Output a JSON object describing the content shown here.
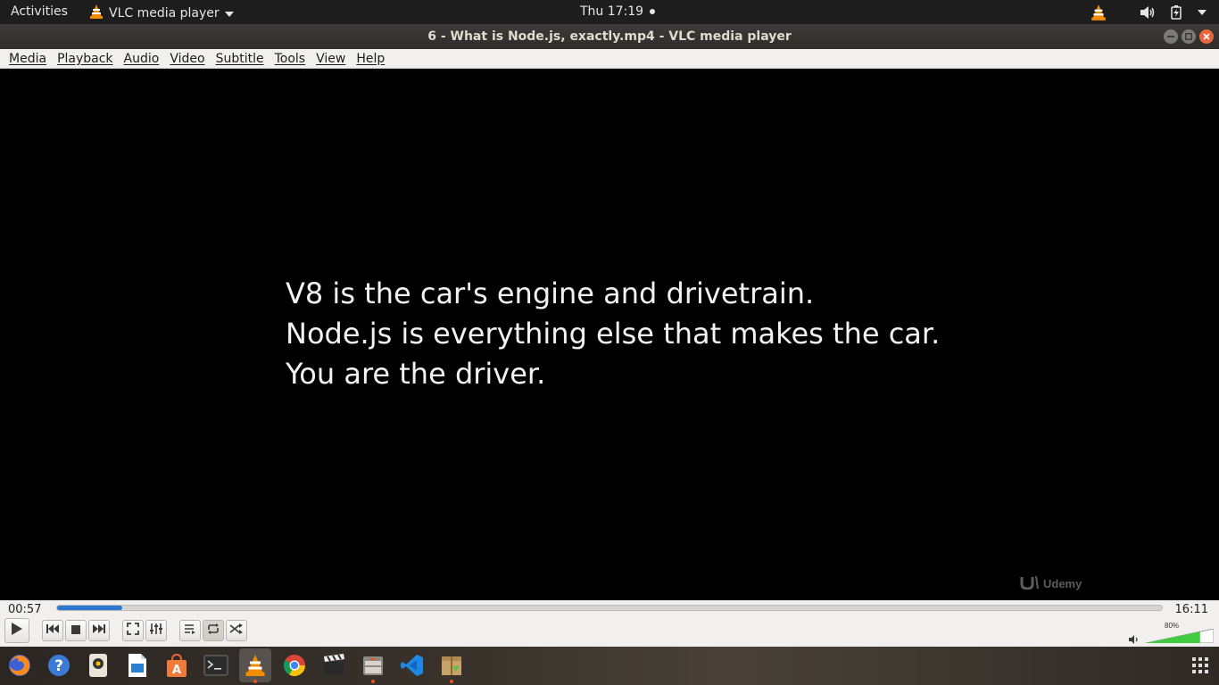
{
  "topbar": {
    "activities": "Activities",
    "app_name": "VLC media player",
    "clock": "Thu 17:19"
  },
  "window": {
    "title": "6 - What is Node.js, exactly.mp4 - VLC media player"
  },
  "menu": [
    "Media",
    "Playback",
    "Audio",
    "Video",
    "Subtitle",
    "Tools",
    "View",
    "Help"
  ],
  "video": {
    "lines": [
      "V8 is the car's engine and drivetrain.",
      "Node.js is everything else that makes the car.",
      "You are the driver."
    ],
    "watermark": "Udemy"
  },
  "controls": {
    "elapsed": "00:57",
    "total": "16:11",
    "progress_fraction": 0.059,
    "volume_label": "80%",
    "volume_fraction": 0.8
  },
  "dock": {
    "apps": [
      "firefox-icon",
      "help-icon",
      "rhythmbox-icon",
      "libreoffice-writer-icon",
      "software-center-icon",
      "terminal-icon",
      "vlc-icon",
      "chrome-icon",
      "video-editor-icon",
      "file-manager-icon",
      "vscode-icon",
      "archive-icon"
    ]
  },
  "colors": {
    "accent": "#2c78d2",
    "vlc_orange": "#f28c00",
    "close_button": "#e9663b"
  }
}
